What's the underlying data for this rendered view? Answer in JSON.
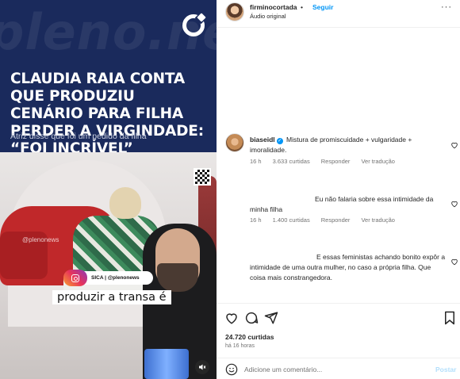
{
  "media": {
    "brand_watermark": "pleno.news",
    "headline": "CLAUDIA RAIA CONTA QUE PRODUZIU CENÁRIO PARA FILHA PERDER A VIRGINDADE: “FOI INCRÍVEL”",
    "subheadline": "Atriz disse que foi um pedido da filha",
    "video_watermark": "@plenonews",
    "handle_tag": "SICA | @plenonews",
    "subtitle": "produzir a transa é",
    "icons": {
      "logo": "pleno-logo-icon",
      "instagram": "instagram-icon",
      "volume": "volume-icon"
    }
  },
  "post": {
    "username": "firminocortada",
    "bullet": "•",
    "follow_label": "Seguir",
    "audio_label": "Áudio original",
    "more_label": "···"
  },
  "comments": [
    {
      "user": "biaseidl",
      "verified": true,
      "text": "Mistura de promiscuidade + vulgaridade + imoralidade.",
      "time": "16 h",
      "likes": "3.633 curtidas",
      "reply": "Responder",
      "translate": "Ver tradução"
    },
    {
      "user": "",
      "text": "Eu não falaria sobre essa intimidade da minha filha",
      "time": "16 h",
      "likes": "1.400 curtidas",
      "reply": "Responder",
      "translate": "Ver tradução"
    },
    {
      "user": "",
      "text": "E essas feministas achando bonito expôr a intimidade de uma outra mulher, no caso a própria filha. Que coisa mais constrangedora."
    }
  ],
  "footer": {
    "likes": "24.720 curtidas",
    "time": "há 16 horas",
    "comment_placeholder": "Adicione um comentário...",
    "post_label": "Postar"
  },
  "colors": {
    "accent": "#0095f6",
    "media_bg": "#1a2a5c",
    "muted": "#737373"
  }
}
